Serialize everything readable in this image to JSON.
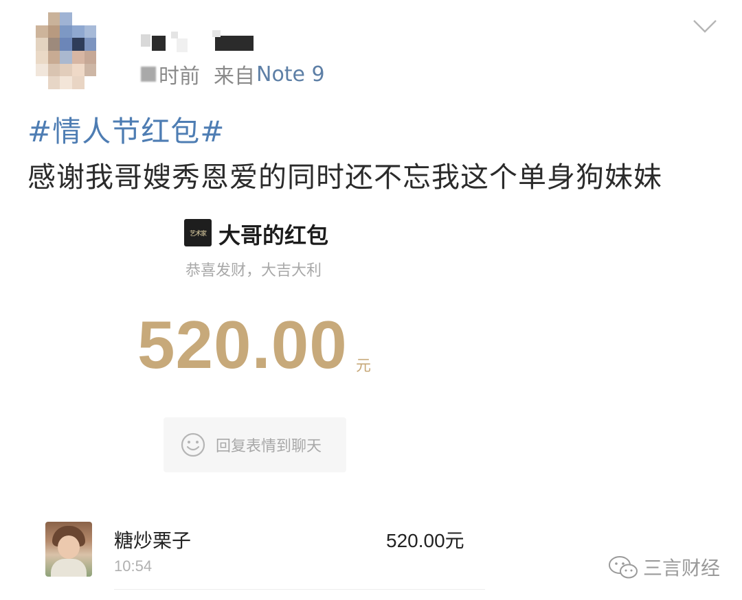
{
  "post": {
    "time_suffix": "时前",
    "source_prefix": "来自",
    "source_device": "Note 9",
    "hashtag": "#情人节红包#",
    "text": "感谢我哥嫂秀恩爱的同时还不忘我这个单身狗妹妹"
  },
  "red_packet": {
    "title": "大哥的红包",
    "subtitle": "恭喜发财，大吉大利",
    "amount": "520.00",
    "unit": "元",
    "reply_label": "回复表情到聊天"
  },
  "record": {
    "name": "糖炒栗子",
    "amount": "520.00元",
    "time": "10:54"
  },
  "watermark": {
    "text": "三言财经"
  },
  "icons": {
    "menu": "chevron-down-icon",
    "reply": "smile-face-icon",
    "watermark": "wechat-logo-icon"
  },
  "colors": {
    "link_blue": "#4e7db3",
    "gold": "#c7a97a",
    "meta_gray": "#8a8a8a"
  }
}
